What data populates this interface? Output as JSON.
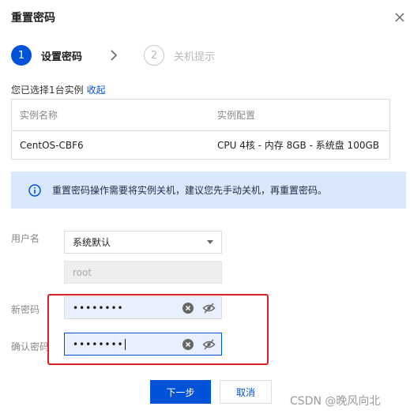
{
  "dialog": {
    "title": "重置密码"
  },
  "steps": [
    {
      "number": "1",
      "label": "设置密码",
      "state": "active"
    },
    {
      "number": "2",
      "label": "关机提示",
      "state": "inactive"
    }
  ],
  "selection": {
    "text": "您已选择1台实例",
    "collapse_link": "收起"
  },
  "table": {
    "headers": [
      "实例名称",
      "实例配置"
    ],
    "rows": [
      [
        "CentOS-CBF6",
        "CPU 4核 - 内存 8GB - 系统盘 100GB"
      ]
    ]
  },
  "notice": {
    "text": "重置密码操作需要将实例关机，建议您先手动关机，再重置密码。"
  },
  "form": {
    "username_label": "用户名",
    "username_select_value": "系统默认",
    "username_readonly_value": "root",
    "new_password_label": "新密码",
    "new_password_value": "••••••••",
    "confirm_password_label": "确认密码",
    "confirm_password_value": "••••••••"
  },
  "buttons": {
    "next": "下一步",
    "cancel": "取消"
  },
  "watermark": "CSDN @晚风向北",
  "colors": {
    "primary": "#0052d9",
    "notice_bg": "#d9e8fd",
    "highlight": "#e02020"
  }
}
